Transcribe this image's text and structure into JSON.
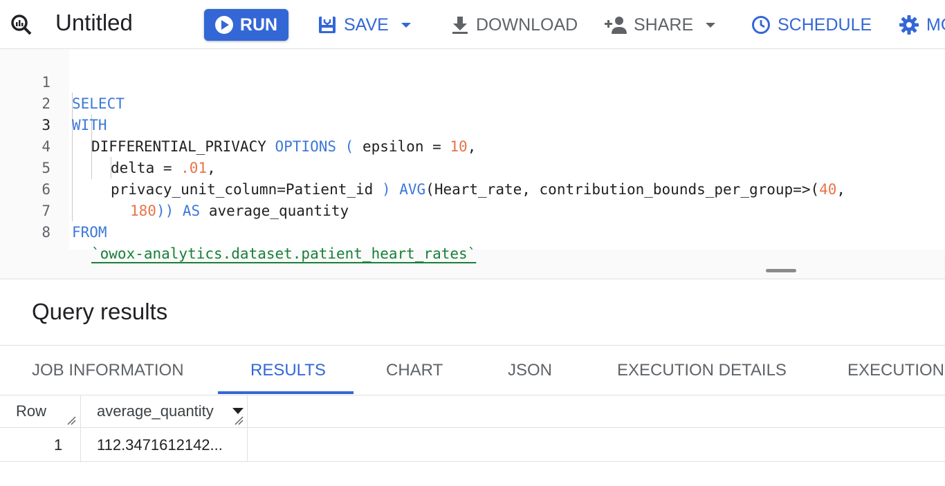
{
  "toolbar": {
    "title": "Untitled",
    "run_label": "RUN",
    "save_label": "SAVE",
    "download_label": "DOWNLOAD",
    "share_label": "SHARE",
    "schedule_label": "SCHEDULE",
    "more_label": "MO",
    "brand_color": "#3367d6",
    "icons": [
      "query-icon",
      "play-icon",
      "save-icon",
      "download-icon",
      "person-add-icon",
      "clock-icon",
      "gear-icon"
    ]
  },
  "editor": {
    "line_numbers": [
      "1",
      "2",
      "3",
      "4",
      "5",
      "6",
      "7",
      "8"
    ],
    "active_line": "3",
    "lines": {
      "l1": {
        "kw": "SELECT"
      },
      "l2": {
        "kw": "WITH"
      },
      "l3": {
        "a": "DIFFERENTIAL_PRIVACY ",
        "kw": "OPTIONS",
        "b": " ( ",
        "c": "epsilon = ",
        "num": "10",
        "d": ","
      },
      "l4": {
        "a": "delta = ",
        "num": ".01",
        "d": ","
      },
      "l5": {
        "a": "privacy_unit_column=Patient_id ",
        "b": ") ",
        "kw": "AVG",
        "c": "(Heart_rate, contribution_bounds_per_group=>(",
        "num": "40",
        "d": ","
      },
      "l6": {
        "num": "180",
        "b": ")) ",
        "kw": "AS",
        "c": " average_quantity"
      },
      "l7": {
        "kw": "FROM"
      },
      "l8": {
        "str": "`owox-analytics.dataset.patient_heart_rates`"
      }
    }
  },
  "results": {
    "title": "Query results",
    "tabs": [
      "JOB INFORMATION",
      "RESULTS",
      "CHART",
      "JSON",
      "EXECUTION DETAILS",
      "EXECUTION"
    ],
    "active_tab": "RESULTS",
    "columns": [
      "Row",
      "average_quantity"
    ],
    "rows": [
      [
        "1",
        "112.3471612142..."
      ]
    ]
  }
}
